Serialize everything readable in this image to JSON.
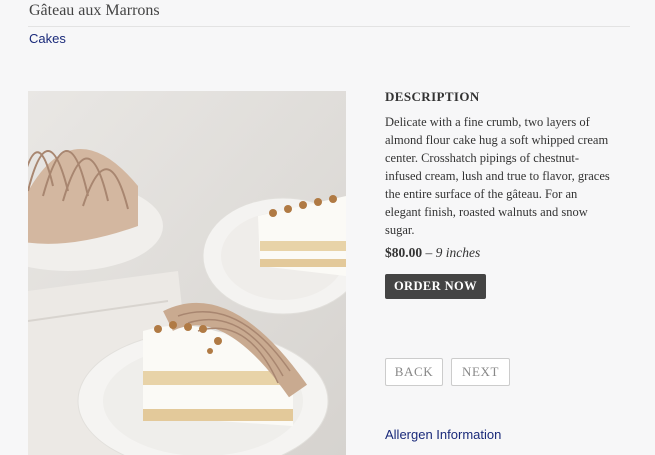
{
  "product": {
    "title": "Gâteau aux Marrons",
    "category_link": "Cakes",
    "description_heading": "DESCRIPTION",
    "description": "Delicate with a fine crumb, two layers of almond flour cake hug a soft whipped cream center. Crosshatch pipings of chestnut-infused cream, lush and true to flavor, graces the entire surface of the gâteau. For an elegant finish, roasted walnuts and snow sugar.",
    "price": "$80.00",
    "price_separator": " – ",
    "size": "9 inches",
    "order_label": "ORDER NOW"
  },
  "navigation": {
    "back_label": "BACK",
    "next_label": "NEXT"
  },
  "footer": {
    "allergen_link": "Allergen Information"
  },
  "photo": {
    "icon": "cake-photo",
    "colors": {
      "background": "#e4e1de",
      "plate": "#f3f2f0",
      "cream": "#c9aa90",
      "sponge": "#e8d3a8",
      "filling": "#fbfaf6",
      "walnut": "#b07a44",
      "napkin": "#ebe8e4"
    }
  }
}
